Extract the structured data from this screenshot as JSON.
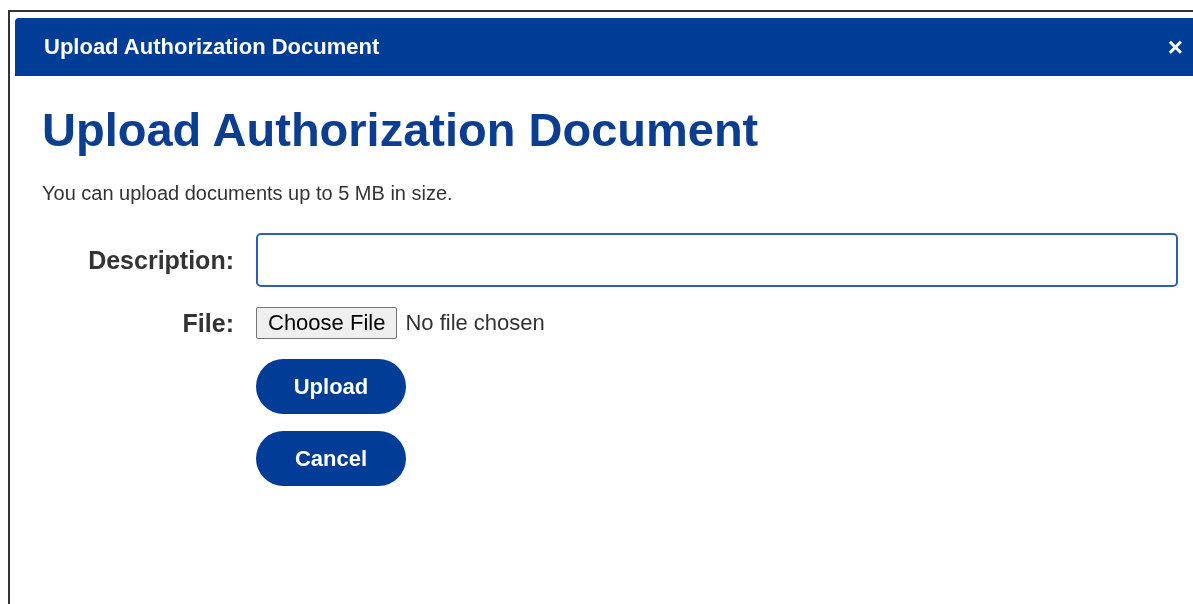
{
  "dialog": {
    "title": "Upload Authorization Document",
    "close": "×"
  },
  "heading": "Upload Authorization Document",
  "note": "You can upload documents up to 5 MB in size.",
  "fields": [
    {
      "kind": "text",
      "label": "Description:"
    },
    {
      "kind": "file",
      "label": "File:",
      "button": "Choose File",
      "status": "No file chosen"
    }
  ],
  "buttons": [
    "Upload",
    "Cancel"
  ]
}
